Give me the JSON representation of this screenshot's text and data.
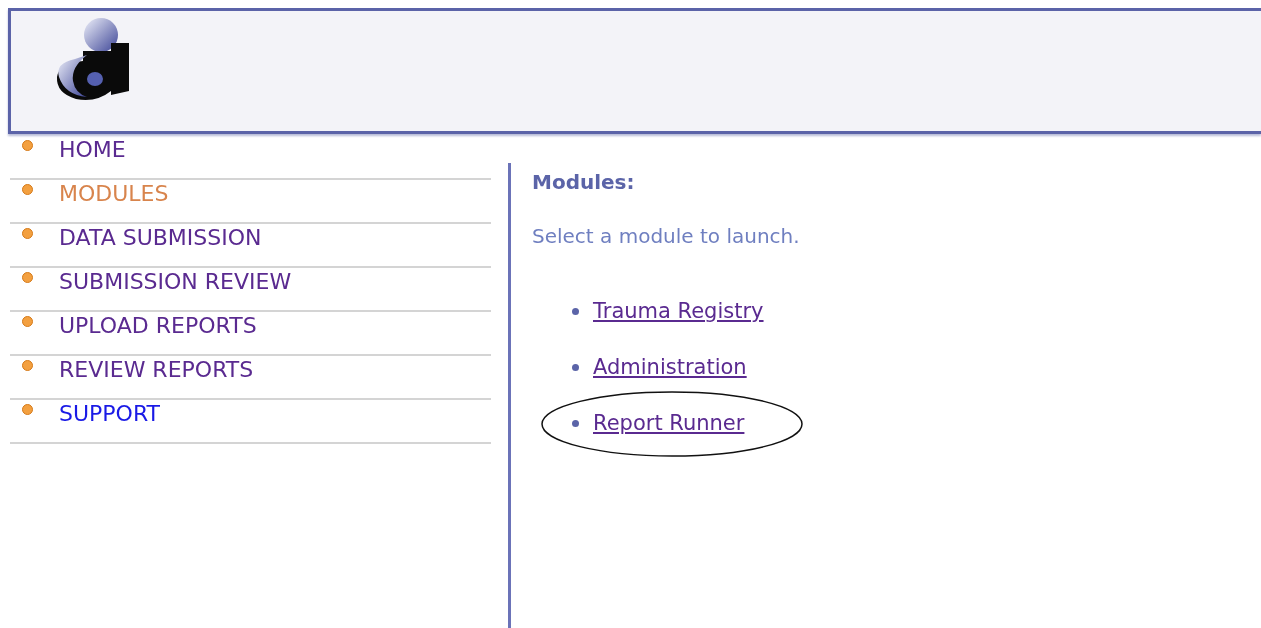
{
  "nav": [
    {
      "label": "HOME",
      "selected": false,
      "visited": true
    },
    {
      "label": "MODULES",
      "selected": true
    },
    {
      "label": "DATA SUBMISSION",
      "selected": false,
      "visited": true
    },
    {
      "label": "SUBMISSION REVIEW",
      "selected": false,
      "visited": true
    },
    {
      "label": "UPLOAD REPORTS",
      "selected": false,
      "visited": true
    },
    {
      "label": "REVIEW REPORTS",
      "selected": false,
      "visited": true
    },
    {
      "label": "SUPPORT",
      "selected": false,
      "visited": false
    }
  ],
  "content": {
    "heading": "Modules:",
    "instruction": "Select a module to launch.",
    "modules": [
      {
        "label": "Trauma Registry",
        "circled": false
      },
      {
        "label": "Administration",
        "circled": false
      },
      {
        "label": "Report Runner",
        "circled": true
      }
    ]
  }
}
